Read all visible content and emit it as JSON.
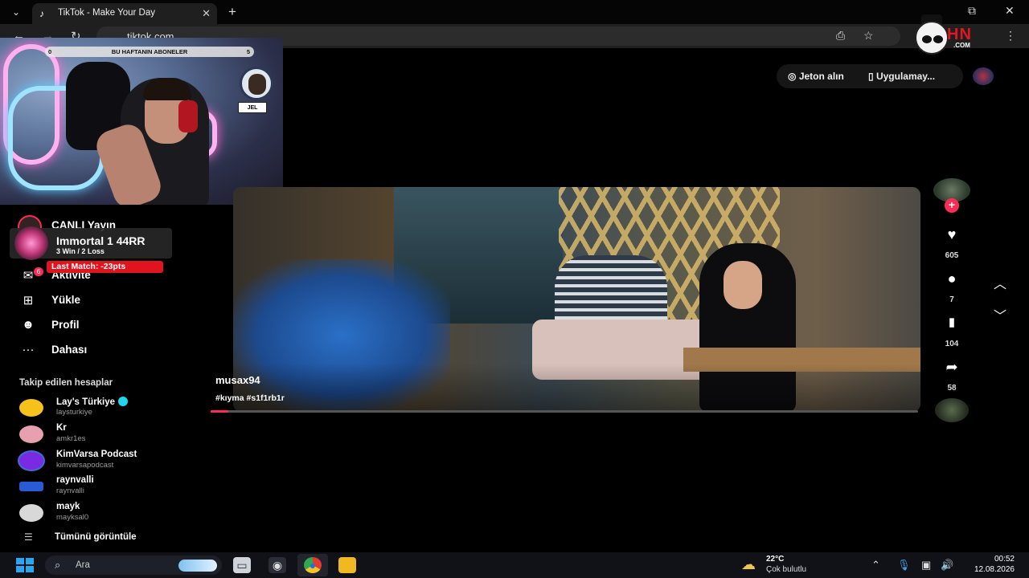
{
  "browser": {
    "tab_title": "TikTok - Make Your Day",
    "tab_favicon": "tiktok-icon",
    "new_tab_label": "+",
    "close_label": "✕",
    "url": "tiktok.com"
  },
  "overlay": {
    "sub_bar_left": "0",
    "sub_bar_title": "BU HAFTANIN ABONELER",
    "sub_bar_right": "5",
    "badge_label": "JEL",
    "logo_text": "HN",
    "logo_sub": ".COM",
    "rank_title": "Immortal 1  44RR",
    "rank_sub": "3 Win / 2 Loss",
    "last_match": "Last Match: -23pts"
  },
  "header": {
    "coins": "Jeton alın",
    "get_app": "Uygulamay..."
  },
  "sidebar": {
    "live": "CANLI Yayın",
    "items": [
      {
        "label": "Aktivite",
        "icon": "inbox-icon",
        "badge": "6"
      },
      {
        "label": "Yükle",
        "icon": "upload-icon"
      },
      {
        "label": "Profil",
        "icon": "profile-icon"
      },
      {
        "label": "Dahası",
        "icon": "more-icon"
      }
    ],
    "following_title": "Takip edilen hesaplar",
    "following": [
      {
        "name": "Lay's Türkiye",
        "handle": "laysturkiye",
        "verified": true,
        "color": "#f4c21b"
      },
      {
        "name": "Kr",
        "handle": "amkr1es",
        "verified": false,
        "color": "#e6a0b0"
      },
      {
        "name": "KimVarsa Podcast",
        "handle": "kimvarsapodcast",
        "verified": false,
        "color": "#7a2be2"
      },
      {
        "name": "raynvalli",
        "handle": "raynvalli",
        "verified": false,
        "color": "#2a5bd6"
      },
      {
        "name": "mayk",
        "handle": "mayksal0",
        "verified": false,
        "color": "#d8d8d8"
      }
    ],
    "see_all": "Tümünü görüntüle"
  },
  "video": {
    "author": "musax94",
    "tags": "#kıyma #s1f1rb1r",
    "progress": 0.025
  },
  "actions": {
    "likes": "605",
    "comments": "7",
    "bookmarks": "104",
    "shares": "58"
  },
  "taskbar": {
    "search_placeholder": "Ara",
    "temperature": "22°C",
    "weather": "Çok bulutlu",
    "time": "00:52",
    "date": "12.08.2026"
  },
  "colors": {
    "accent": "#fe2c55",
    "verified": "#20d5ec",
    "last_match_bar": "#e0141f"
  }
}
